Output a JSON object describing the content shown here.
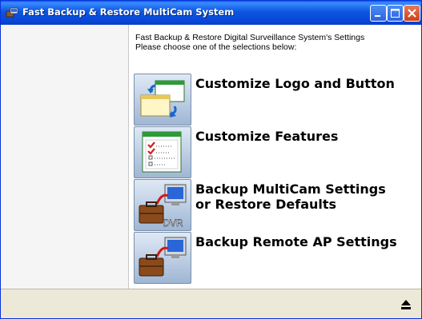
{
  "window": {
    "title": "Fast Backup & Restore MultiCam System",
    "accent_color": "#0a5ae0",
    "close_color": "#c9421c"
  },
  "header": {
    "line1": "Fast Backup & Restore Digital Surveillance System's Settings",
    "line2": "Please choose one of the selections below:"
  },
  "menu": {
    "items": [
      {
        "label": "Customize Logo and Button",
        "icon": "windows-swap-icon"
      },
      {
        "label": "Customize Features",
        "icon": "checklist-window-icon"
      },
      {
        "label": "Backup MultiCam Settings\nor Restore Defaults",
        "icon": "dvr-briefcase-icon",
        "badge": "DVR"
      },
      {
        "label": "Backup Remote AP Settings",
        "icon": "briefcase-computer-icon"
      }
    ]
  },
  "statusbar": {
    "eject_icon": "eject-icon"
  }
}
